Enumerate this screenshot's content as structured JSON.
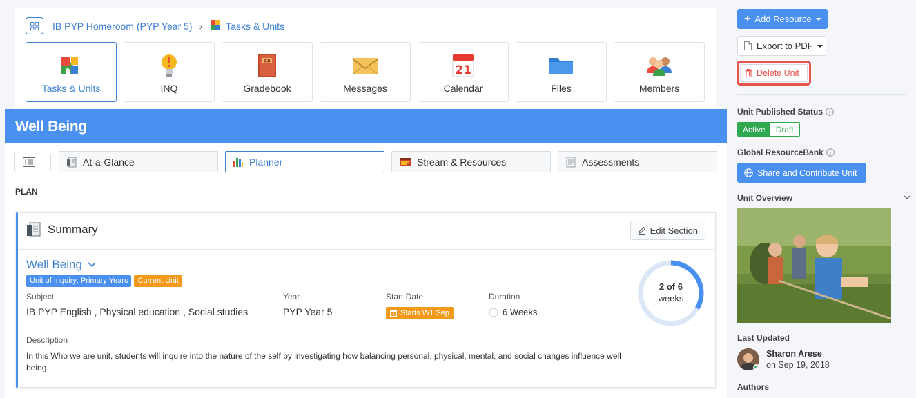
{
  "breadcrumb": {
    "home": "IB PYP Homeroom (PYP Year 5)",
    "current": "Tasks & Units"
  },
  "tiles": [
    {
      "label": "Tasks & Units",
      "icon": "puzzle-icon",
      "active": true
    },
    {
      "label": "INQ",
      "icon": "lightbulb-icon"
    },
    {
      "label": "Gradebook",
      "icon": "gradebook-icon"
    },
    {
      "label": "Messages",
      "icon": "envelope-icon"
    },
    {
      "label": "Calendar",
      "icon": "calendar-icon",
      "calendar_day": "21"
    },
    {
      "label": "Files",
      "icon": "folder-icon"
    },
    {
      "label": "Members",
      "icon": "members-icon"
    }
  ],
  "unit": {
    "header_title": "Well Being"
  },
  "subtabs": [
    {
      "label": "At-a-Glance",
      "icon": "document-icon"
    },
    {
      "label": "Planner",
      "icon": "planner-icon",
      "active": true
    },
    {
      "label": "Stream & Resources",
      "icon": "stream-icon"
    },
    {
      "label": "Assessments",
      "icon": "assessment-icon"
    }
  ],
  "plan_label": "PLAN",
  "summary": {
    "title": "Summary",
    "edit_label": "Edit Section",
    "unit_title": "Well Being",
    "badges": [
      "Unit of Inquiry: Primary Years",
      "Current Unit"
    ],
    "subject_label": "Subject",
    "subject_value": "IB PYP English , Physical education , Social studies",
    "year_label": "Year",
    "year_value": "PYP Year 5",
    "start_label": "Start Date",
    "start_value": "Starts W1 Sep",
    "duration_label": "Duration",
    "duration_value": "6 Weeks",
    "description_label": "Description",
    "description_text": "In this Who we are unit, students will inquire into the nature of the self by investigating how balancing personal, physical, mental, and social changes influence well being.",
    "progress_line1": "2 of 6",
    "progress_line2": "weeks",
    "progress_fraction": 0.3333
  },
  "sidebar": {
    "add_resource": "Add Resource",
    "export_pdf": "Export to PDF",
    "delete_unit": "Delete Unit",
    "published_status_label": "Unit Published Status",
    "status_active": "Active",
    "status_draft": "Draft",
    "resource_bank_label": "Global ResourceBank",
    "share_button": "Share and Contribute Unit",
    "overview_label": "Unit Overview",
    "last_updated_label": "Last Updated",
    "updater_name": "Sharon Arese",
    "updated_on": "on Sep 19, 2018",
    "authors_label": "Authors"
  },
  "colors": {
    "accent": "#4a90f0",
    "link": "#3b7fd4",
    "orange": "#f39a1b",
    "success": "#2fa84f",
    "danger": "#e8544d"
  }
}
